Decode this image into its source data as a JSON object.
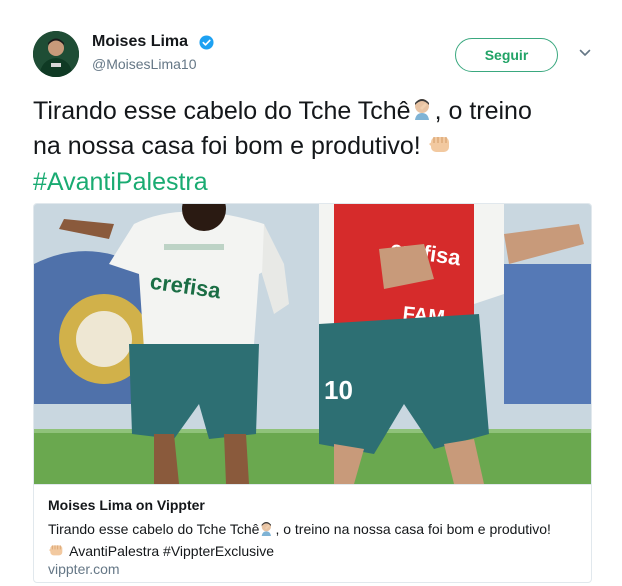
{
  "author": {
    "name": "Moises Lima",
    "handle": "@MoisesLima10"
  },
  "follow_label": "Seguir",
  "tweet": {
    "line1_a": "Tirando esse cabelo do Tche Tchê",
    "line1_b": ", o treino",
    "line2": "na nossa casa foi bom e produtivo!",
    "hashtag": "#AvantiPalestra"
  },
  "card": {
    "title": "Moises Lima on Vippter",
    "desc_a": "Tirando esse cabelo do Tche Tchê",
    "desc_b": ", o treino na nossa casa foi bom e produtivo!",
    "desc_hashtags": "AvantiPalestra  #VippterExclusive",
    "domain": "vippter.com"
  },
  "image_text": {
    "sponsor1": "crefisa",
    "sponsor2": "FAM",
    "number": "10"
  },
  "colors": {
    "accent": "#1aab72",
    "verified": "#1da1f2",
    "bib_red": "#d62b2b",
    "shorts_teal": "#2d6f73"
  },
  "icons": {
    "verified": "verified-badge-icon",
    "caret": "chevron-down-icon",
    "emoji_face": "facepalm-emoji",
    "emoji_fist": "fist-bump-emoji"
  }
}
